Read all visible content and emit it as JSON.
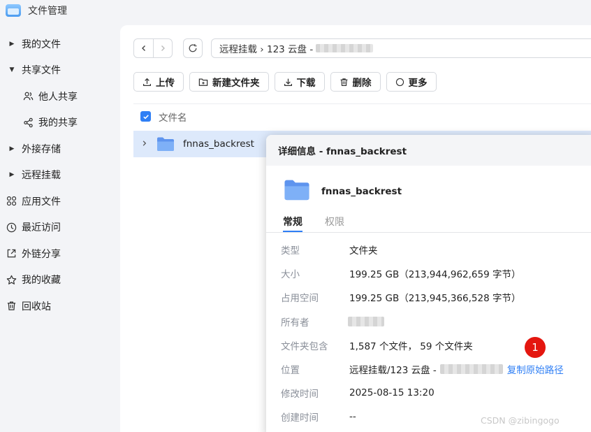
{
  "app": {
    "title": "文件管理",
    "icon": "folder-app-icon"
  },
  "sidebar": {
    "items": [
      {
        "label": "我的文件",
        "icon": "caret-right-icon"
      },
      {
        "label": "共享文件",
        "icon": "caret-down-icon"
      },
      {
        "label": "他人共享",
        "icon": "users-icon"
      },
      {
        "label": "我的共享",
        "icon": "share-icon"
      },
      {
        "label": "外接存储",
        "icon": "caret-right-icon"
      },
      {
        "label": "远程挂载",
        "icon": "caret-right-icon"
      },
      {
        "label": "应用文件",
        "icon": "apps-grid-icon"
      },
      {
        "label": "最近访问",
        "icon": "clock-icon"
      },
      {
        "label": "外链分享",
        "icon": "external-share-icon"
      },
      {
        "label": "我的收藏",
        "icon": "star-icon"
      },
      {
        "label": "回收站",
        "icon": "trash-icon"
      }
    ]
  },
  "path": {
    "text": "远程挂载 › 123 云盘 -"
  },
  "toolbar": {
    "upload": "上传",
    "new_folder": "新建文件夹",
    "download": "下载",
    "delete": "删除",
    "more": "更多"
  },
  "list": {
    "column_name": "文件名",
    "rows": [
      {
        "name": "fnnas_backrest"
      }
    ]
  },
  "details": {
    "title": "详细信息 - fnnas_backrest",
    "file_name": "fnnas_backrest",
    "tabs": {
      "general": "常规",
      "permissions": "权限"
    },
    "props": [
      {
        "key": "类型",
        "value": "文件夹"
      },
      {
        "key": "大小",
        "value": "199.25 GB（213,944,962,659 字节）"
      },
      {
        "key": "占用空间",
        "value": "199.25 GB（213,945,366,528 字节）"
      },
      {
        "key": "所有者",
        "value": ""
      },
      {
        "key": "文件夹包含",
        "value": "1,587 个文件， 59 个文件夹"
      },
      {
        "key": "位置",
        "value": "远程挂载/123 云盘 -",
        "link": "复制原始路径"
      },
      {
        "key": "修改时间",
        "value": "2025-08-15 13:20"
      },
      {
        "key": "创建时间",
        "value": "--"
      }
    ]
  },
  "annotation": {
    "badge": "1",
    "color": "#e4160f"
  },
  "watermark": "CSDN @zibingogo",
  "colors": {
    "accent": "#2f7ff5",
    "selected_row": "#dde9fb",
    "folder": "#6aa1f5"
  }
}
